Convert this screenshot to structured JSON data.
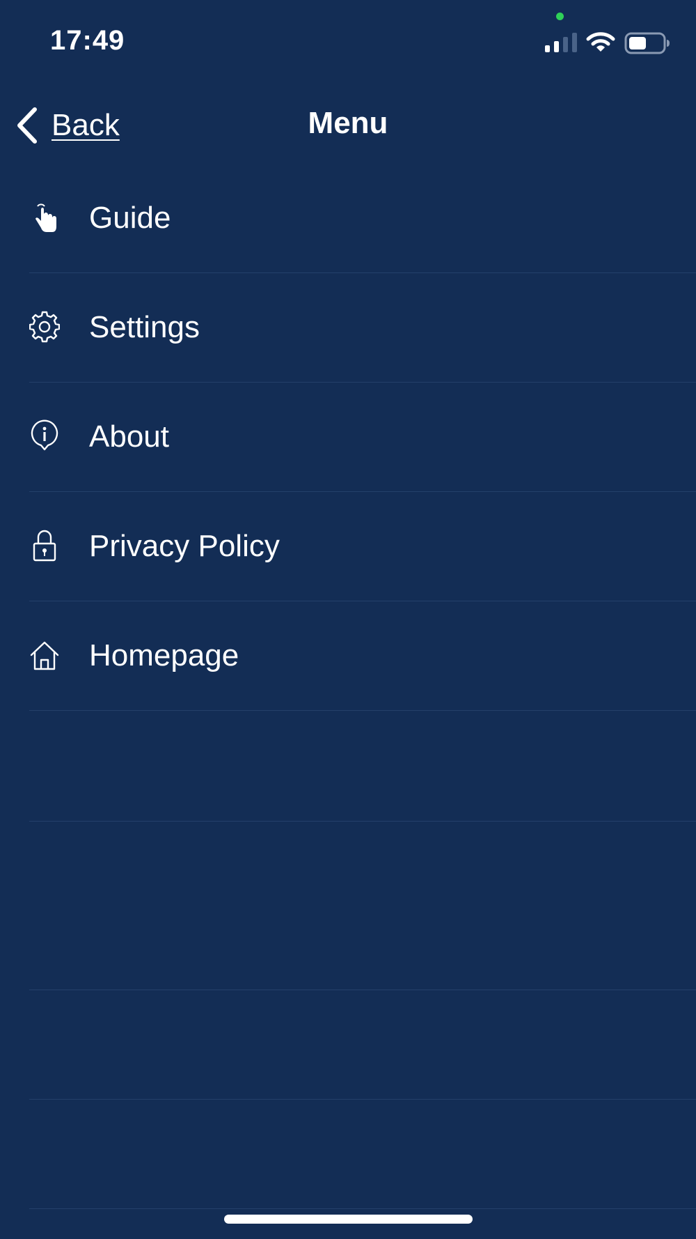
{
  "status_bar": {
    "time": "17:49"
  },
  "nav": {
    "back_label": "Back",
    "title": "Menu"
  },
  "menu": {
    "items": [
      {
        "label": "Guide",
        "icon": "hand-pointer-icon"
      },
      {
        "label": "Settings",
        "icon": "gear-icon"
      },
      {
        "label": "About",
        "icon": "info-icon"
      },
      {
        "label": "Privacy Policy",
        "icon": "lock-icon"
      },
      {
        "label": "Homepage",
        "icon": "home-icon"
      }
    ]
  },
  "colors": {
    "background": "#132d55",
    "text": "#ffffff",
    "divider": "#24406a",
    "privacy_dot": "#2fd158"
  }
}
